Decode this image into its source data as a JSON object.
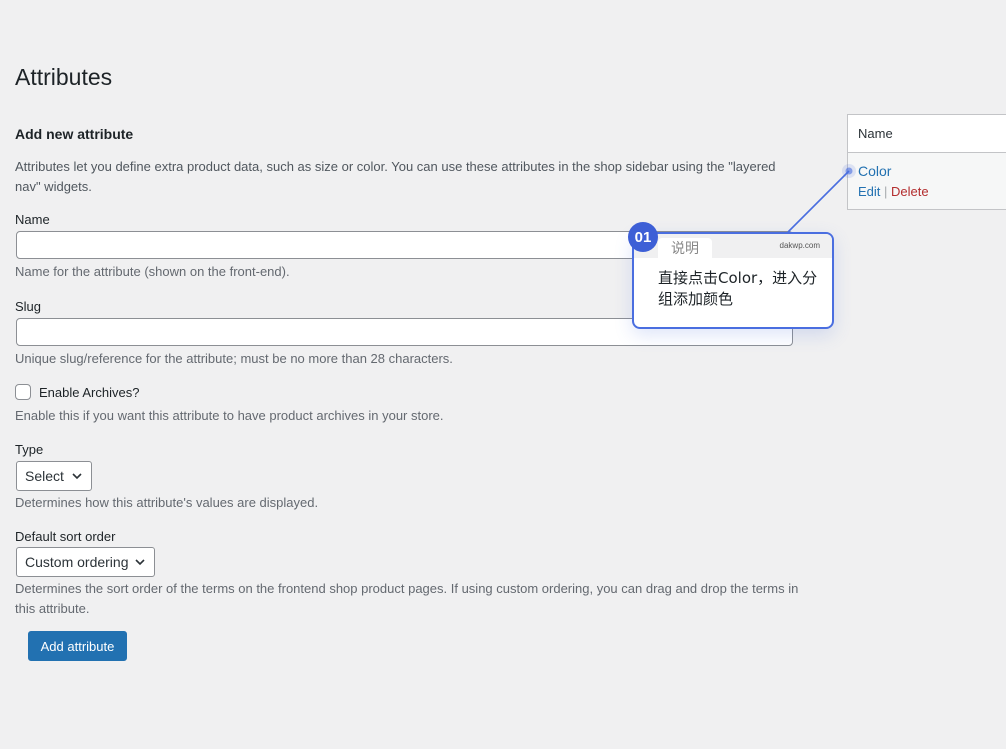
{
  "page": {
    "title": "Attributes"
  },
  "form": {
    "section_title": "Add new attribute",
    "intro": "Attributes let you define extra product data, such as size or color. You can use these attributes in the shop sidebar using the \"layered nav\" widgets.",
    "name_label": "Name",
    "name_value": "",
    "name_desc": "Name for the attribute (shown on the front-end).",
    "slug_label": "Slug",
    "slug_value": "",
    "slug_desc": "Unique slug/reference for the attribute; must be no more than 28 characters.",
    "archives_label": "Enable Archives?",
    "archives_checked": false,
    "archives_desc": "Enable this if you want this attribute to have product archives in your store.",
    "type_label": "Type",
    "type_value": "Select",
    "type_desc": "Determines how this attribute's values are displayed.",
    "sort_label": "Default sort order",
    "sort_value": "Custom ordering",
    "sort_desc": "Determines the sort order of the terms on the frontend shop product pages. If using custom ordering, you can drag and drop the terms in this attribute.",
    "submit_label": "Add attribute"
  },
  "table": {
    "header": "Name",
    "rows": [
      {
        "name": "Color",
        "edit": "Edit",
        "separator": "|",
        "delete": "Delete"
      }
    ]
  },
  "callout": {
    "badge": "01",
    "tab": "说明",
    "brand": "dakwp.com",
    "text": "直接点击Color，进入分组添加颜色"
  },
  "colors": {
    "background": "#f0f0f1",
    "primary": "#2271b1",
    "delete": "#b32d2e",
    "callout_border": "#4a6ee0",
    "badge": "#3d5fd6"
  },
  "icons": {
    "select_arrow": "chevron-down-icon",
    "callout_pointer": "pointer-dot-icon"
  }
}
